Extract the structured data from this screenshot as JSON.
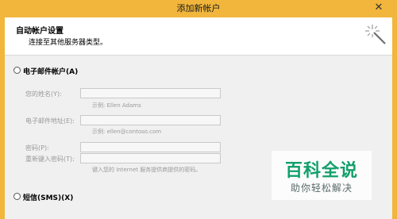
{
  "window": {
    "title": "添加新帐户",
    "frame_color": "#f1b63b"
  },
  "header": {
    "title": "自动帐户设置",
    "subtitle": "连接至其他服务器类型。",
    "icon": "sparkle-wand-icon"
  },
  "email_option": {
    "label": "电子邮件帐户(A)",
    "selected": false
  },
  "form": {
    "name_label": "您的姓名(Y):",
    "name_value": "",
    "name_hint": "示例: Ellen Adams",
    "email_label": "电子邮件地址(E):",
    "email_value": "",
    "email_hint": "示例: ellen@contoso.com",
    "password_label": "密码(P):",
    "password_value": "",
    "retype_label": "重新键入密码(T):",
    "retype_value": "",
    "password_hint": "键入您的 Internet 服务提供商提供的密码。"
  },
  "sms_option": {
    "label": "短信(SMS)(X)",
    "selected": false
  },
  "watermark": {
    "main": "百科全说",
    "sub": "助你轻松解决"
  }
}
